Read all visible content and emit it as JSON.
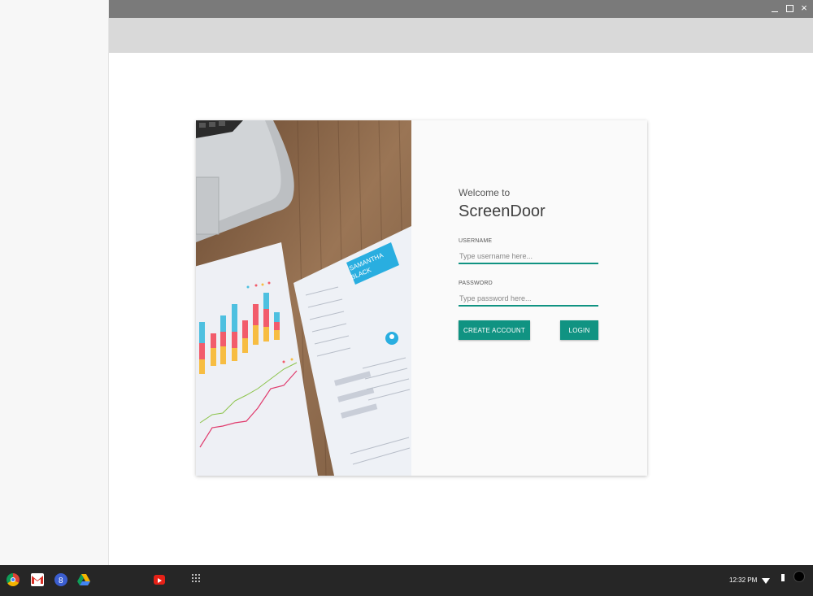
{
  "login": {
    "welcome": "Welcome to",
    "app_name": "ScreenDoor",
    "username_label": "USERNAME",
    "username_placeholder": "Type username here...",
    "password_label": "PASSWORD",
    "password_placeholder": "Type password here...",
    "create_account_label": "CREATE ACCOUNT",
    "login_label": "LOGIN"
  },
  "photo": {
    "resume_name_line1": "SAMANTHA",
    "resume_name_line2": "BLACK"
  },
  "window": {
    "close_glyph": "×"
  },
  "taskbar": {
    "time": "12:32 PM",
    "apps": [
      "chrome-icon",
      "gmail-icon",
      "docs-icon",
      "drive-icon",
      "youtube-icon",
      "launcher-icon"
    ]
  },
  "colors": {
    "accent": "#109382",
    "titlebar": "#7a7a7a",
    "toolbar": "#d9d9d9",
    "taskbar": "#262626"
  }
}
